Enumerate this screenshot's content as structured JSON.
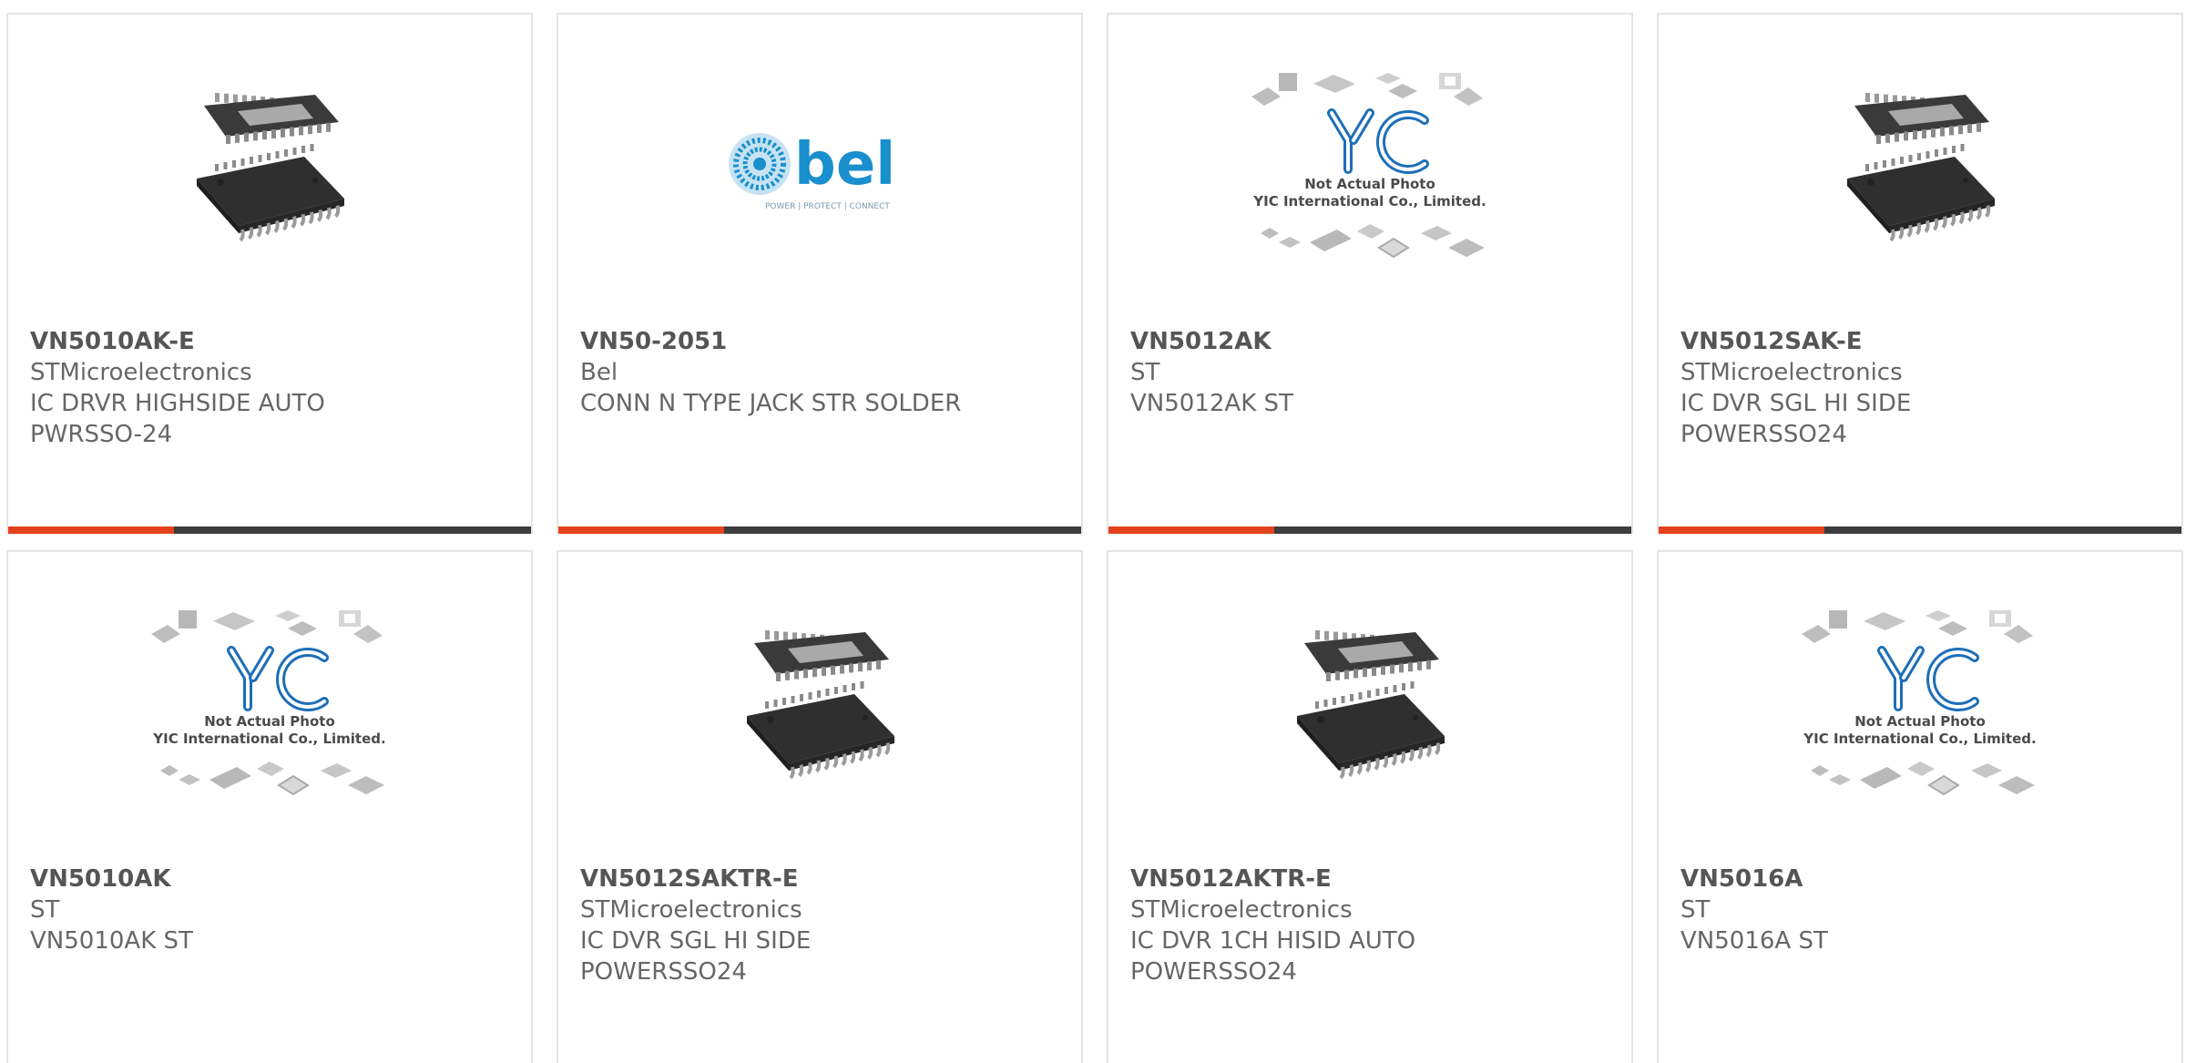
{
  "colors": {
    "accent": "#e4421c",
    "bar": "#3d3d3d",
    "border": "#e4e4e4",
    "yic_blue": "#1d6fb8",
    "bel_blue": "#1a8fce"
  },
  "products": [
    {
      "part_number": "VN5010AK-E",
      "manufacturer": "STMicroelectronics",
      "description_lines": [
        "IC DRVR HIGHSIDE AUTO",
        "PWRSSO-24"
      ],
      "image": "chip-package-image"
    },
    {
      "part_number": "VN50-2051",
      "manufacturer": "Bel",
      "description_lines": [
        "CONN N TYPE JACK STR SOLDER"
      ],
      "image": "bel-logo-image",
      "logo_text": "bel",
      "logo_tagline": "POWER | PROTECT | CONNECT"
    },
    {
      "part_number": "VN5012AK",
      "manufacturer": "ST",
      "description_lines": [
        "VN5012AK ST"
      ],
      "image": "yic-placeholder-image",
      "placeholder_line1": "Not Actual Photo",
      "placeholder_line2": "YIC International Co., Limited."
    },
    {
      "part_number": "VN5012SAK-E",
      "manufacturer": "STMicroelectronics",
      "description_lines": [
        "IC DVR SGL HI SIDE",
        "POWERSSO24"
      ],
      "image": "chip-package-image"
    },
    {
      "part_number": "VN5010AK",
      "manufacturer": "ST",
      "description_lines": [
        "VN5010AK ST"
      ],
      "image": "yic-placeholder-image",
      "placeholder_line1": "Not Actual Photo",
      "placeholder_line2": "YIC International Co., Limited."
    },
    {
      "part_number": "VN5012SAKTR-E",
      "manufacturer": "STMicroelectronics",
      "description_lines": [
        "IC DVR SGL HI SIDE",
        "POWERSSO24"
      ],
      "image": "chip-package-image"
    },
    {
      "part_number": "VN5012AKTR-E",
      "manufacturer": "STMicroelectronics",
      "description_lines": [
        "IC DVR 1CH HISID AUTO",
        "POWERSSO24"
      ],
      "image": "chip-package-image"
    },
    {
      "part_number": "VN5016A",
      "manufacturer": "ST",
      "description_lines": [
        "VN5016A ST"
      ],
      "image": "yic-placeholder-image",
      "placeholder_line1": "Not Actual Photo",
      "placeholder_line2": "YIC International Co., Limited."
    }
  ]
}
